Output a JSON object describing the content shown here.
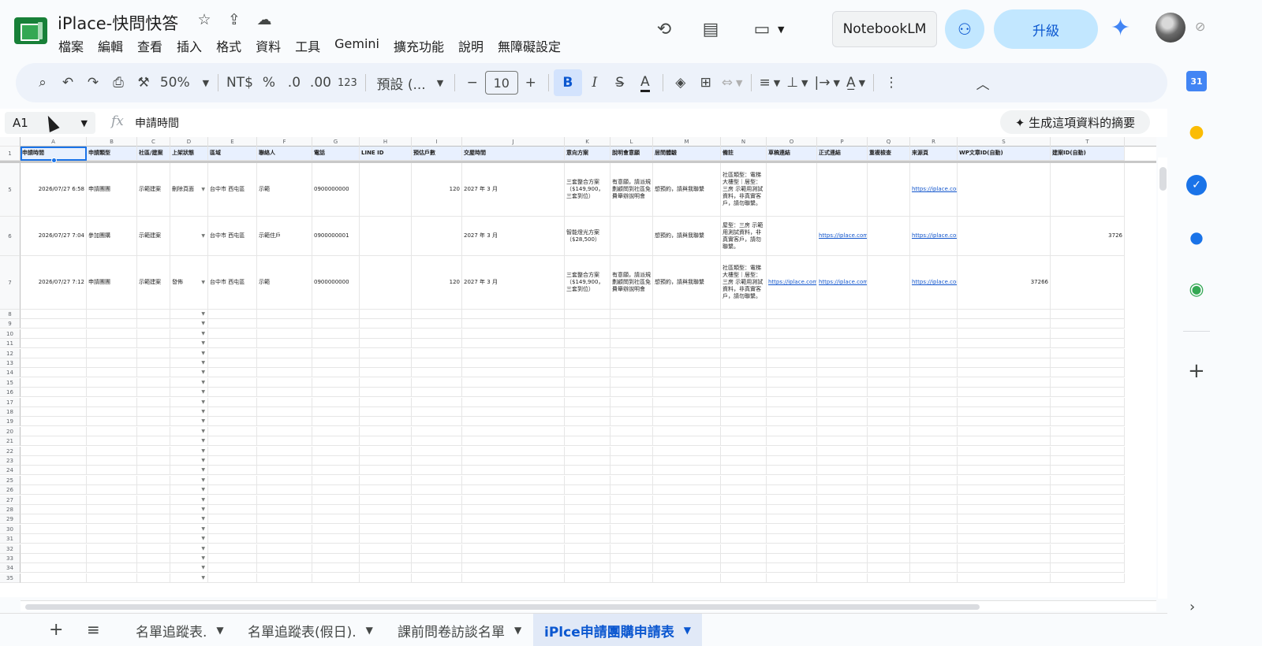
{
  "header": {
    "title": "iPlace-快問快答",
    "menu": [
      "檔案",
      "編輯",
      "查看",
      "插入",
      "格式",
      "資料",
      "工具",
      "Gemini",
      "擴充功能",
      "說明",
      "無障礙設定"
    ],
    "notebooklm_label": "NotebookLM",
    "upgrade_label": "升級"
  },
  "toolbar": {
    "zoom": "50%",
    "currency": "NT$",
    "percent": "%",
    "dec_decrease": ".0",
    "dec_increase": ".00",
    "number_format": "123",
    "font": "預設 (...",
    "font_size": "10",
    "bold": "B",
    "italic": "I",
    "textcolor": "A"
  },
  "formula_bar": {
    "cell_ref": "A1",
    "fx": "fx",
    "value": "申請時間",
    "summary_label": "✦ 生成這項資料的摘要"
  },
  "grid": {
    "col_letters": [
      "A",
      "B",
      "C",
      "D",
      "E",
      "F",
      "G",
      "H",
      "I",
      "J",
      "K",
      "L",
      "M",
      "N",
      "O",
      "P",
      "Q",
      "R",
      "S",
      "T"
    ],
    "headers": [
      "申請時間",
      "申請類型",
      "社區/建案",
      "上架狀態",
      "區域",
      "聯絡人",
      "電話",
      "LINE ID",
      "預估戶數",
      "交屋時間",
      "意向方案",
      "說明會意願",
      "居問體驗",
      "備註",
      "草稿連結",
      "正式連結",
      "重複檢查",
      "來源頁",
      "WP文章ID(自動)",
      "建案ID(自動)"
    ],
    "rows": [
      {
        "row_no": "5",
        "time": "2026/07/27 6:58",
        "type": "申請團團",
        "community": "示範建案",
        "status": "刪除頁面",
        "area": "台中市 西屯區",
        "contact": "示範",
        "phone": "0900000000",
        "line_id": "",
        "households": "120",
        "handover": "2027 年 3 月",
        "plan": "三套整合方案（$149,900，三套到位）",
        "briefing": "有意願，請派規劃顧問到社區免費舉辦說明會",
        "experience": "想預約，請與我聯繫",
        "note": "社區類型：電梯大樓型｜居型：三房 示範用測試資料，非真實客戶，請勿聯繫。",
        "draft": "",
        "official": "",
        "dup": "",
        "source": "https://iplace.com.tw/smart-home-group-buy/?nocs",
        "wp_id": "",
        "case_id": ""
      },
      {
        "row_no": "6",
        "time": "2026/07/27 7:04",
        "type": "參加團購",
        "community": "示範建案",
        "status": "",
        "area": "台中市 西屯區",
        "contact": "示範住戶",
        "phone": "0900000001",
        "line_id": "",
        "households": "",
        "handover": "2027 年 3 月",
        "plan": "智能燈光方案（$28,500）",
        "briefing": "",
        "experience": "想預約，請與我聯繫",
        "note": "屋型：三房 示範用測試資料，非真實客戶，請勿聯繫。",
        "draft": "",
        "official": "https://iplace.com.",
        "dup": "",
        "source": "https://iplace.com.tw/community/?nocache=17851",
        "wp_id": "",
        "case_id": "3726"
      },
      {
        "row_no": "7",
        "time": "2026/07/27 7:12",
        "type": "申請團團",
        "community": "示範建案",
        "status": "發佈",
        "area": "台中市 西屯區",
        "contact": "示範",
        "phone": "0900000000",
        "line_id": "",
        "households": "120",
        "handover": "2027 年 3 月",
        "plan": "三套整合方案（$149,900，三套到位）",
        "briefing": "有意願，請派規劃顧問到社區免費舉辦說明會",
        "experience": "想預約，請與我聯繫",
        "note": "社區類型：電梯大樓型｜居型：三房 示範用測試資料，非真實客戶，請勿聯繫。",
        "draft": "https://iplace.com.",
        "official": "https://iplace.com.",
        "dup": "",
        "source": "https://iplace.cor",
        "wp_id": "37266",
        "case_id": ""
      }
    ],
    "empty_rows": [
      "8",
      "9",
      "10",
      "11",
      "12",
      "13",
      "14",
      "15",
      "16",
      "17",
      "18",
      "19",
      "20",
      "21",
      "22",
      "23",
      "24",
      "25",
      "26",
      "27",
      "28",
      "29",
      "30",
      "31",
      "32",
      "33",
      "34",
      "35"
    ]
  },
  "sheets": [
    {
      "label": "名單追蹤表.",
      "active": false
    },
    {
      "label": "名單追蹤表(假日).",
      "active": false
    },
    {
      "label": "課前問卷訪談名單",
      "active": false
    },
    {
      "label": "iPlce申請團購申請表",
      "active": true
    }
  ],
  "side_panel": {
    "calendar_day": "31"
  }
}
